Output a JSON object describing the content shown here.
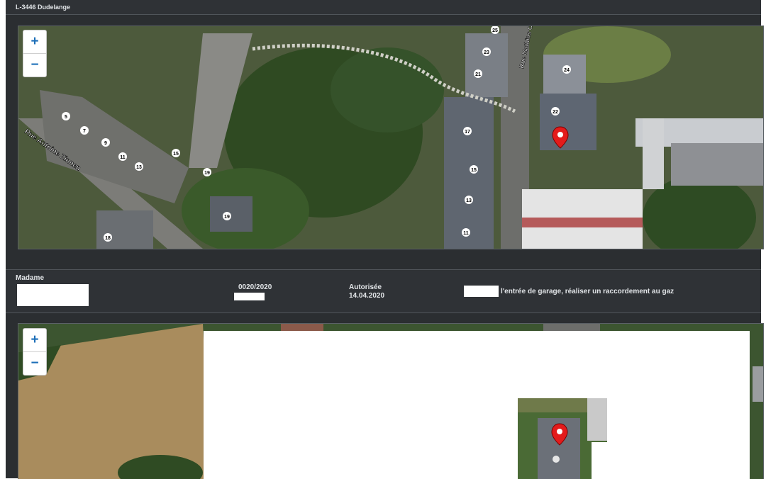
{
  "top_row": {
    "address": "L-3446 Dudelange"
  },
  "map1": {
    "zoom_in": "+",
    "zoom_out": "−",
    "street_1": "Rue Antoine Zinnen",
    "street_2": "Rue Mathias C",
    "house_numbers": [
      "25",
      "23",
      "21",
      "24",
      "22",
      "17",
      "15",
      "13",
      "11",
      "5",
      "7",
      "9",
      "11",
      "13",
      "15",
      "19",
      "19",
      "18"
    ]
  },
  "record": {
    "title": "Madame",
    "dossier_number": "0020/2020",
    "status": "Autorisée",
    "status_date": "14.04.2020",
    "description": "l'entrée de garage, réaliser un raccordement au gaz"
  },
  "map2": {
    "zoom_in": "+",
    "zoom_out": "−"
  },
  "colors": {
    "panel_bg": "#2b2e31",
    "zoom_blue": "#1d6fb8",
    "marker_red": "#e31b1b"
  }
}
